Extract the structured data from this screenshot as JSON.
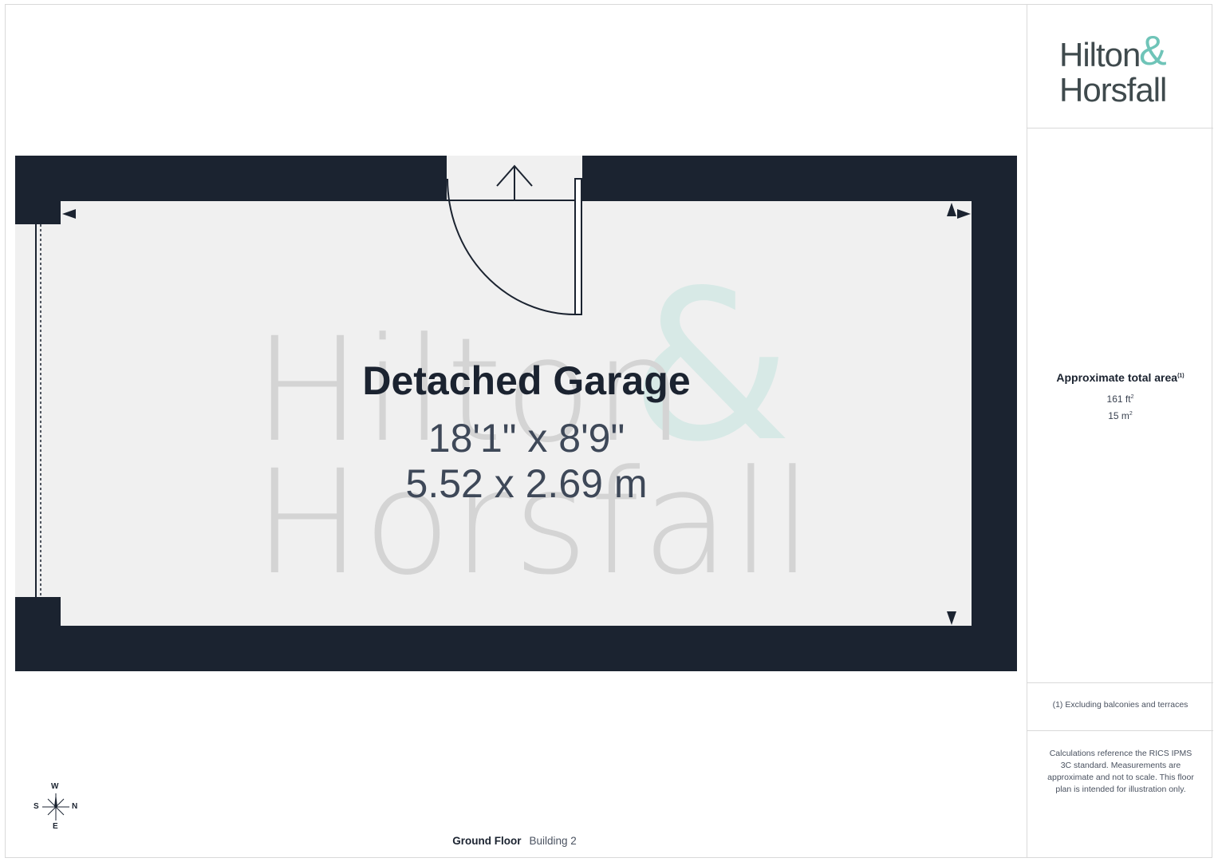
{
  "brand": {
    "line1": "Hilton",
    "amp": "&",
    "line2": "Horsfall"
  },
  "room": {
    "name": "Detached Garage",
    "imperial": "18'1\" x 8'9\"",
    "metric": "5.52 x 2.69 m"
  },
  "area": {
    "title": "Approximate total area",
    "title_note": "(1)",
    "sqft": "161 ft",
    "sqft_sup": "2",
    "sqm": "15 m",
    "sqm_sup": "2"
  },
  "footnote": "(1) Excluding balconies and terraces",
  "disclaimer": "Calculations reference the RICS IPMS 3C standard. Measurements are approximate and not to scale. This floor plan is intended for illustration only.",
  "floor": {
    "name": "Ground Floor",
    "building": "Building 2"
  },
  "compass": {
    "top": "W",
    "left": "S",
    "right": "N",
    "bottom": "E"
  },
  "colors": {
    "wall": "#1b2330",
    "floor": "#f0f0f0",
    "accent": "#6fc4b8",
    "text": "#1b2330"
  }
}
